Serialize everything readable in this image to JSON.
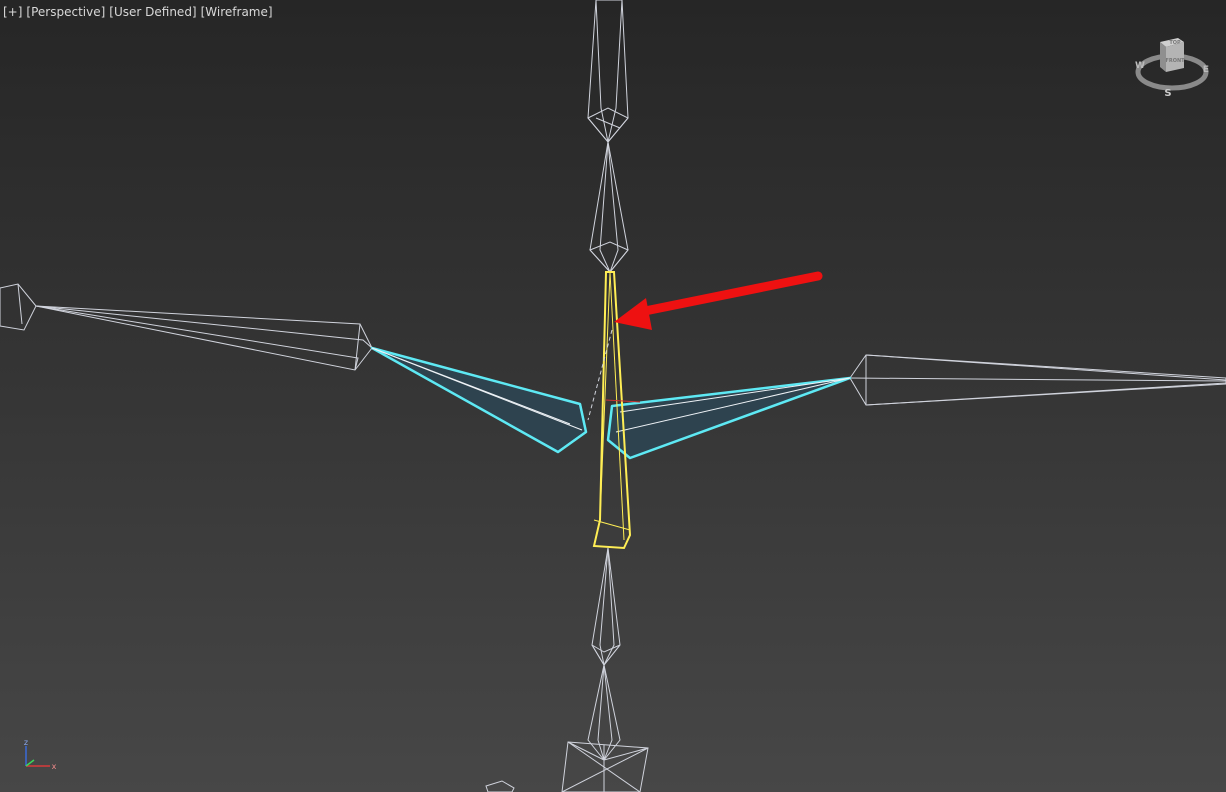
{
  "viewport": {
    "menu_plus": "[+]",
    "view_type": "[Perspective]",
    "shading_label": "[User Defined]",
    "render_mode": "[Wireframe]"
  },
  "viewcube": {
    "top_face": "TOP",
    "front_face": "FRONT",
    "west": "W",
    "east": "E",
    "south": "S"
  },
  "axis_tripod": {
    "z": "z",
    "x": "x"
  },
  "colors": {
    "wire_bone": "#d0d3dc",
    "selected": "#ffee55",
    "highlighted": "#5ee9f4",
    "highlight_fill": "#2d4552",
    "annotation_arrow": "#ee1111"
  },
  "icons": {
    "viewcube": "viewcube-icon",
    "axis_tripod": "axis-tripod-icon",
    "annotation": "red-arrow-annotation"
  }
}
